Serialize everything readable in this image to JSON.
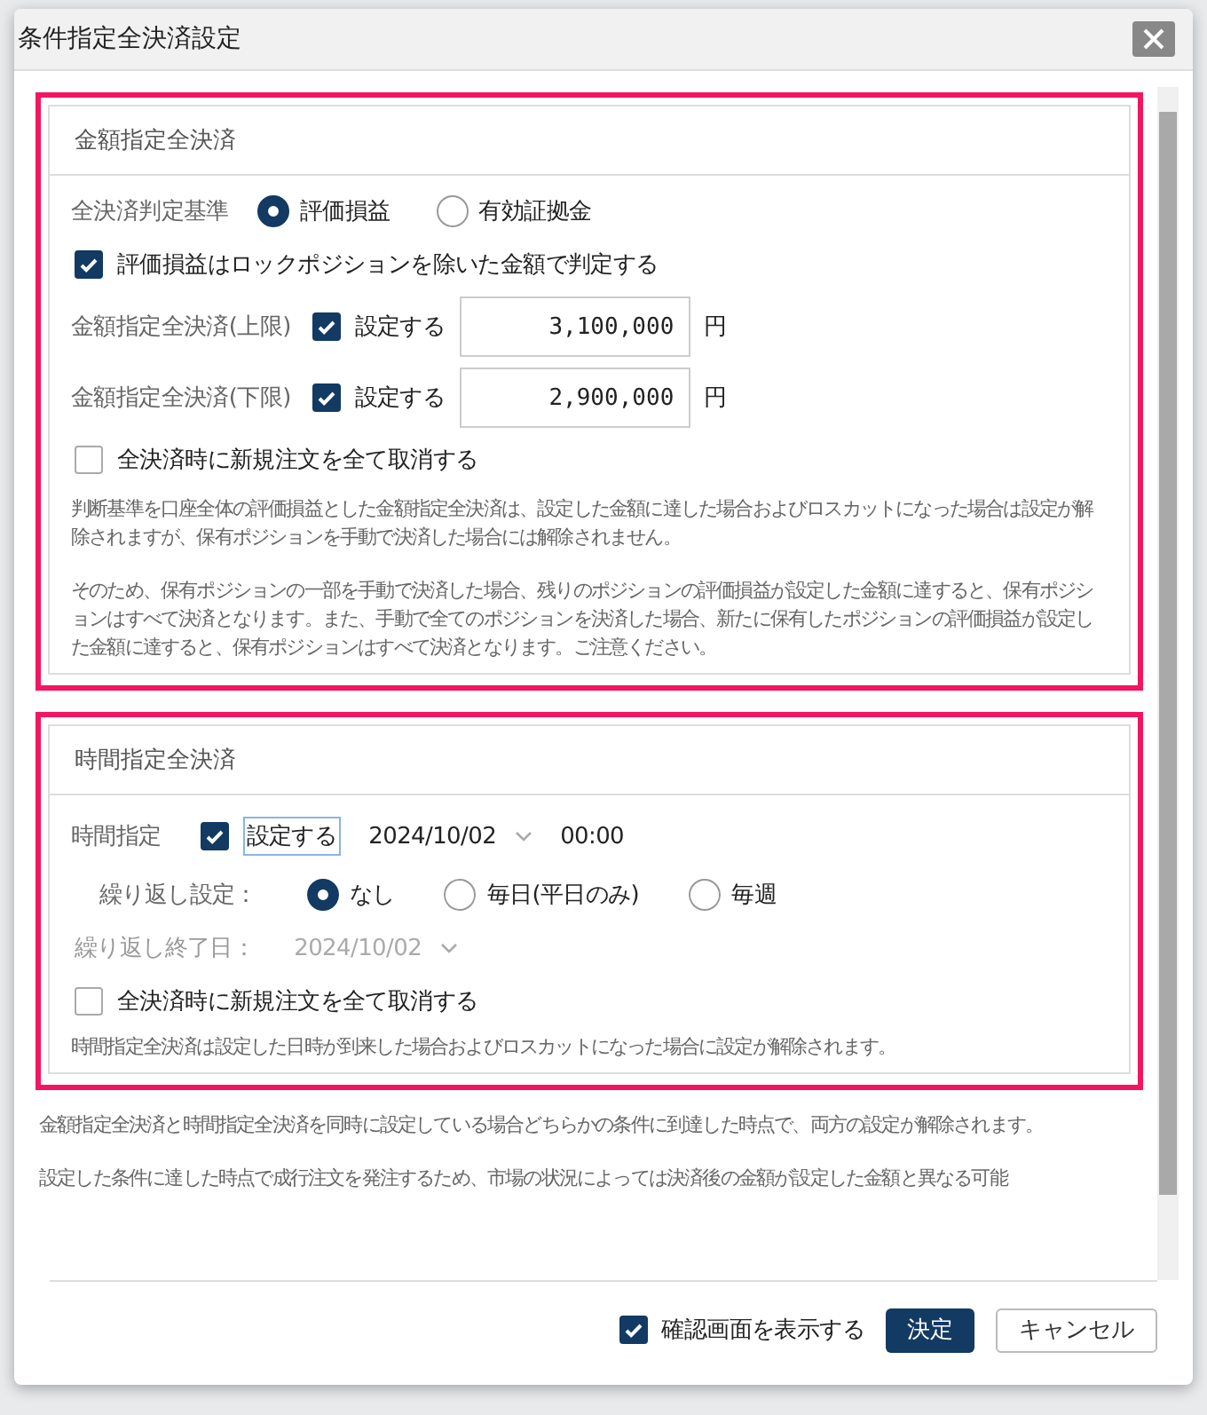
{
  "dialog": {
    "title": "条件指定全決済設定"
  },
  "amount_section": {
    "highlighted": true,
    "title": "金額指定全決済",
    "basis": {
      "label": "全決済判定基準",
      "options": [
        {
          "label": "評価損益",
          "selected": true
        },
        {
          "label": "有効証拠金",
          "selected": false
        }
      ]
    },
    "exclude_lock": {
      "label": "評価損益はロックポジションを除いた金額で判定する",
      "checked": true
    },
    "limits": [
      {
        "label": "金額指定全決済(上限)",
        "checkbox_label": "設定する",
        "checked": true,
        "value": "3,100,000",
        "unit": "円"
      },
      {
        "label": "金額指定全決済(下限)",
        "checkbox_label": "設定する",
        "checked": true,
        "value": "2,900,000",
        "unit": "円"
      }
    ],
    "cancel_orders": {
      "label": "全決済時に新規注文を全て取消する",
      "checked": false
    },
    "notes": [
      "判断基準を口座全体の評価損益とした金額指定全決済は、設定した金額に達した場合およびロスカットになった場合は設定が解除されますが、保有ポジションを手動で決済した場合には解除されません。",
      "そのため、保有ポジションの一部を手動で決済した場合、残りのポジションの評価損益が設定した金額に達すると、保有ポジションはすべて決済となります。また、手動で全てのポジションを決済した場合、新たに保有したポジションの評価損益が設定した金額に達すると、保有ポジションはすべて決済となります。ご注意ください。"
    ]
  },
  "time_section": {
    "highlighted": true,
    "title": "時間指定全決済",
    "time": {
      "label": "時間指定",
      "checkbox_label": "設定する",
      "checked": true,
      "focused": true,
      "date": "2024/10/02",
      "time": "00:00"
    },
    "repeat": {
      "label": "繰り返し設定：",
      "options": [
        {
          "label": "なし",
          "selected": true
        },
        {
          "label": "毎日(平日のみ)",
          "selected": false
        },
        {
          "label": "毎週",
          "selected": false
        }
      ]
    },
    "repeat_end": {
      "label": "繰り返し終了日：",
      "date": "2024/10/02",
      "disabled": true
    },
    "cancel_orders": {
      "label": "全決済時に新規注文を全て取消する",
      "checked": false
    },
    "note": "時間指定全決済は設定した日時が到来した場合およびロスカットになった場合に設定が解除されます。"
  },
  "general_notes": [
    "金額指定全決済と時間指定全決済を同時に設定している場合どちらかの条件に到達した時点で、両方の設定が解除されます。",
    "設定した条件に達した時点で成行注文を発注するため、市場の状況によっては決済後の金額が設定した金額と異なる可能"
  ],
  "footer": {
    "confirm": {
      "label": "確認画面を表示する",
      "checked": true
    },
    "ok": "決定",
    "cancel": "キャンセル"
  }
}
